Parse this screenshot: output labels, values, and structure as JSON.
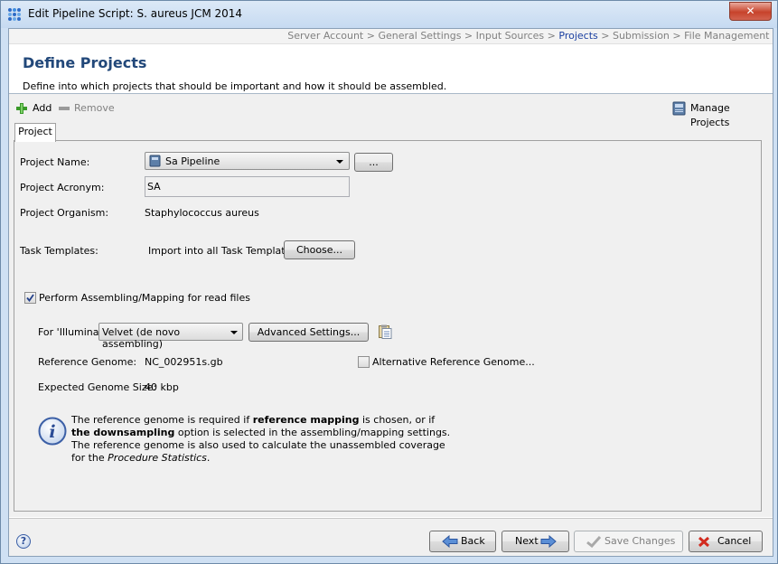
{
  "window": {
    "title": "Edit Pipeline Script: S. aureus JCM 2014",
    "close_label": "✕"
  },
  "breadcrumb": {
    "items": [
      {
        "label": "Server Account",
        "active": false
      },
      {
        "label": "General Settings",
        "active": false
      },
      {
        "label": "Input Sources",
        "active": false
      },
      {
        "label": "Projects",
        "active": true
      },
      {
        "label": "Submission",
        "active": false
      },
      {
        "label": "File Management",
        "active": false
      }
    ],
    "separator": " > "
  },
  "header": {
    "title": "Define Projects",
    "description": "Define into which projects that should be important and how it should be assembled."
  },
  "toolbar": {
    "add_label": "Add",
    "remove_label": "Remove",
    "manage_label": "Manage Projects"
  },
  "tabs": [
    {
      "label": "Project",
      "selected": true
    }
  ],
  "form": {
    "project_name_label": "Project Name:",
    "project_name_value": "Sa Pipeline",
    "ellipsis_label": "...",
    "acronym_label": "Project Acronym:",
    "acronym_value": "SA",
    "organism_label": "Project Organism:",
    "organism_value": "Staphylococcus aureus",
    "task_templates_label": "Task Templates:",
    "import_label": "Import into all Task Templates",
    "choose_label": "Choose...",
    "perform_label": "Perform Assembling/Mapping for read files",
    "perform_checked": true,
    "for_label": "For 'Illumina':",
    "assembler_value": "Velvet (de novo assembling)",
    "advanced_label": "Advanced Settings...",
    "reference_label": "Reference Genome:",
    "reference_value": "NC_002951s.gb",
    "alt_reference_label": "Alternative Reference Genome...",
    "alt_reference_checked": false,
    "genome_size_label": "Expected Genome Size:",
    "genome_size_value": "40 kbp"
  },
  "info": {
    "line1_a": "The reference genome is required if ",
    "line1_b": "reference mapping",
    "line1_c": " is chosen, or if",
    "line2_a": "the downsampling",
    "line2_b": " option is selected in the assembling/mapping settings.",
    "line3": "The reference genome is also used to calculate the unassembled coverage",
    "line4_a": "for the ",
    "line4_b": "Procedure Statistics",
    "line4_c": "."
  },
  "footer": {
    "back_label": "Back",
    "next_label": "Next",
    "save_label": "Save Changes",
    "cancel_label": "Cancel",
    "help_label": "?"
  },
  "colors": {
    "title_blue": "#22487a",
    "accent_blue": "#1a3fa0",
    "disabled_gray": "#808080"
  }
}
